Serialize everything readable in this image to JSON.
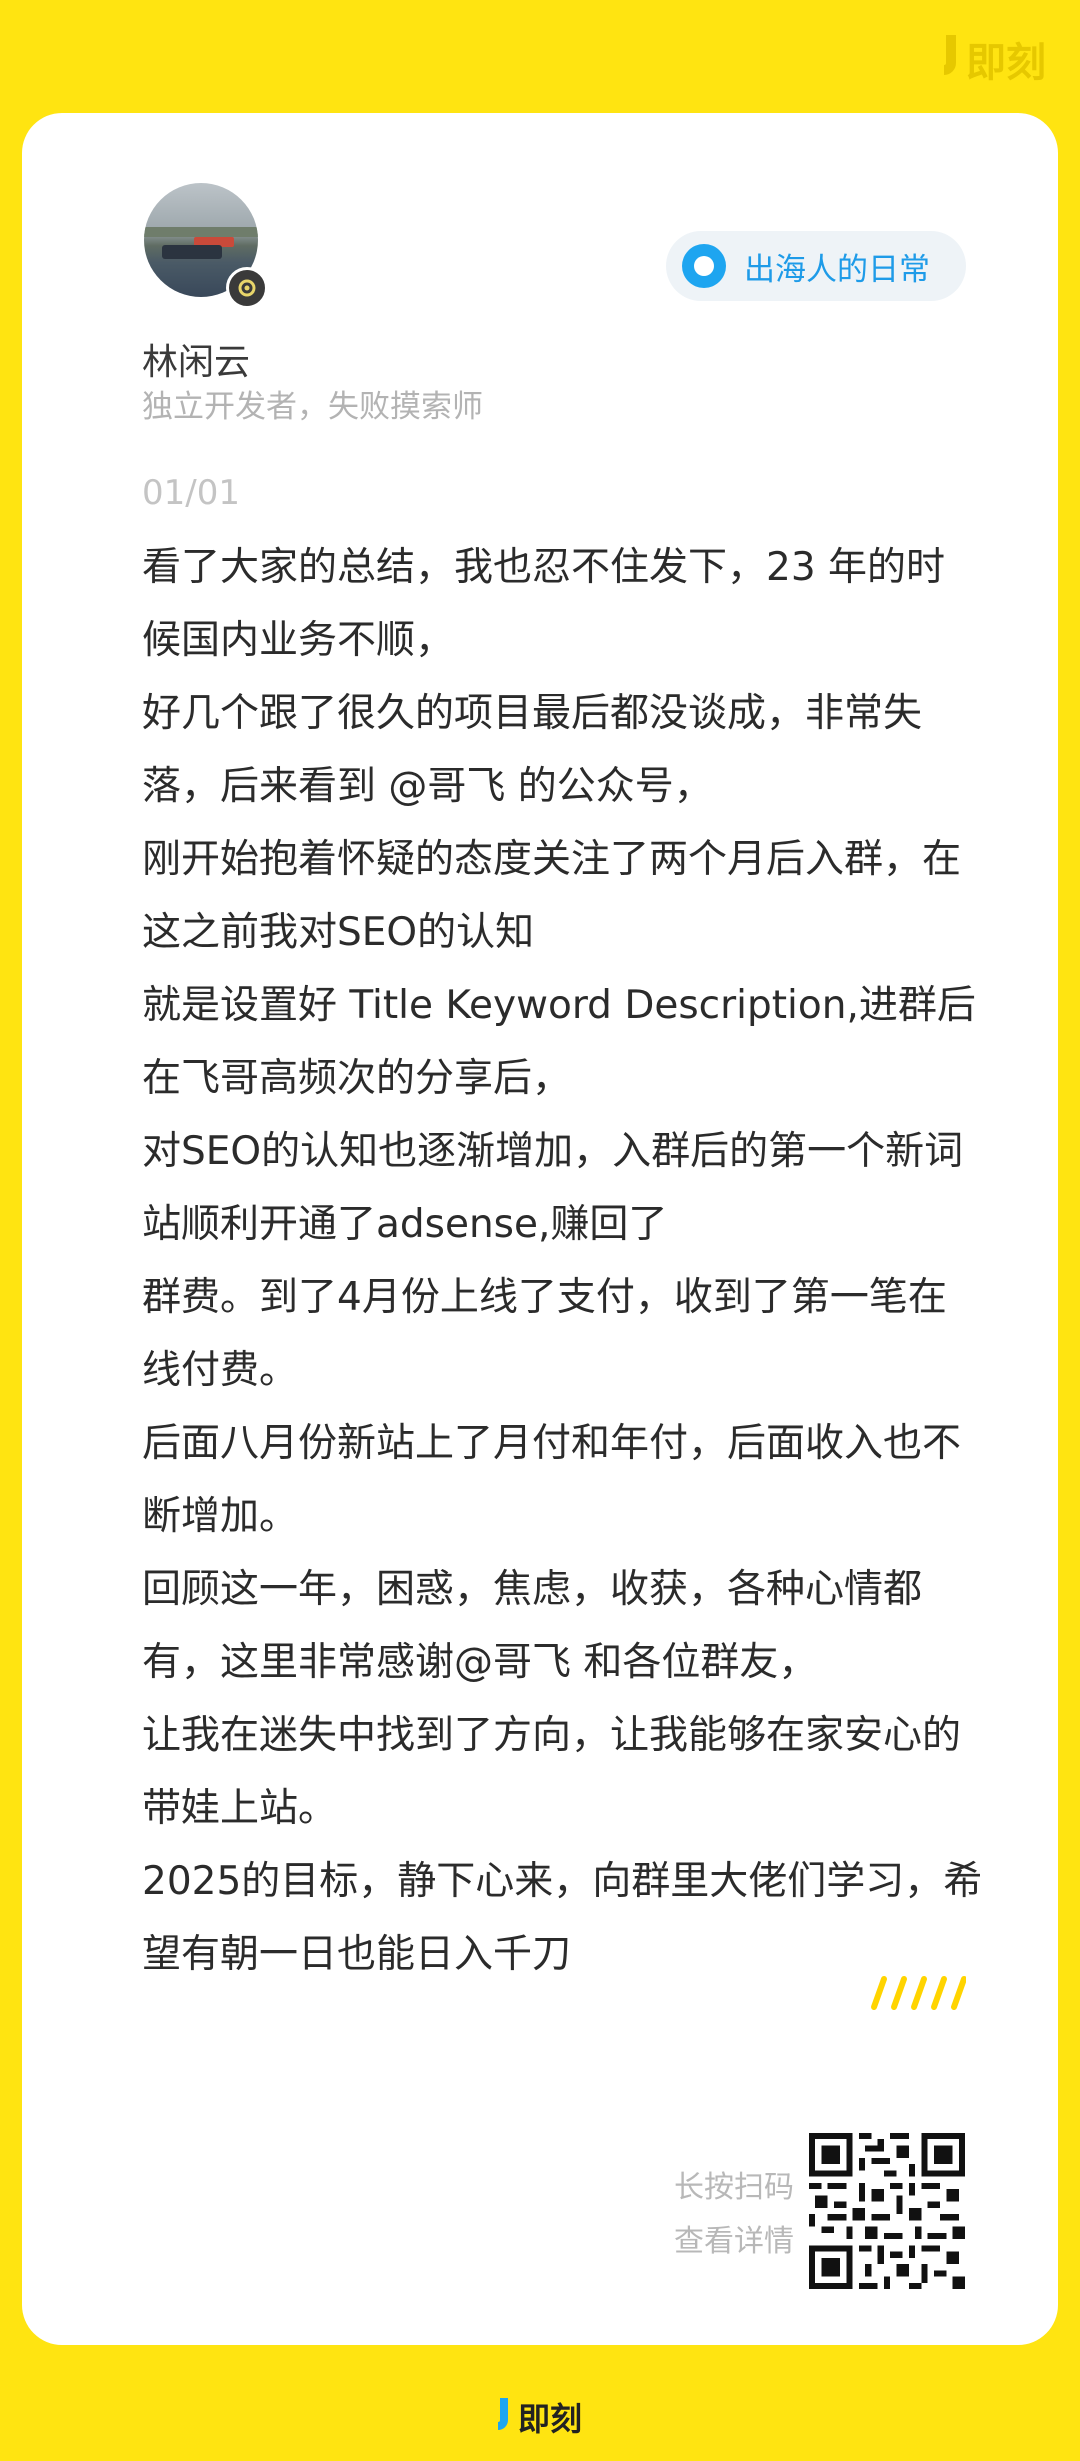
{
  "brand": {
    "top_logo_text": "即刻",
    "bottom_logo_text": "即刻"
  },
  "author": {
    "name": "林闲云",
    "bio": "独立开发者，失败摸索师"
  },
  "topic": {
    "label": "出海人的日常"
  },
  "post": {
    "page_index": "01/01",
    "paragraphs": [
      "看了大家的总结，我也忍不住发下，23 年的时候国内业务不顺，",
      "好几个跟了很久的项目最后都没谈成，非常失落，后来看到 @哥飞 的公众号，",
      "刚开始抱着怀疑的态度关注了两个月后入群，在这之前我对SEO的认知",
      "就是设置好 Title Keyword Description,进群后在飞哥高频次的分享后，",
      "对SEO的认知也逐渐增加，入群后的第一个新词站顺利开通了adsense,赚回了",
      "群费。到了4月份上线了支付，收到了第一笔在线付费。",
      "后面八月份新站上了月付和年付，后面收入也不断增加。",
      "回顾这一年，困惑，焦虑，收获，各种心情都有，这里非常感谢@哥飞 和各位群友，",
      "让我在迷失中找到了方向，让我能够在家安心的带娃上站。",
      "2025的目标，静下心来，向群里大佬们学习，希望有朝一日也能日入千刀"
    ]
  },
  "qr": {
    "hint_line1": "长按扫码",
    "hint_line2": "查看详情"
  },
  "colors": {
    "background": "#FFE411",
    "accent_blue": "#1EA5F0",
    "card": "#FFFFFF"
  }
}
